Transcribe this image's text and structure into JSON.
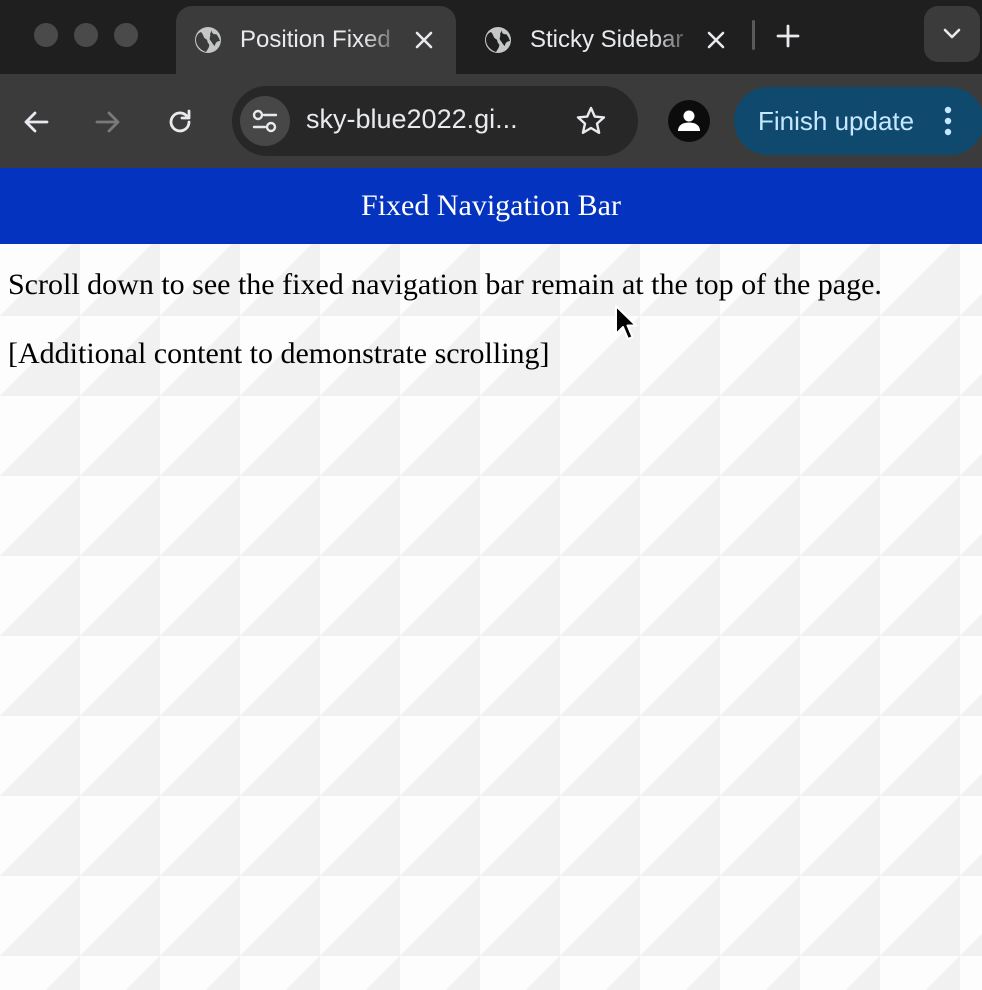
{
  "browser": {
    "tabs": [
      {
        "title": "Position Fixed",
        "active": true,
        "icon": "globe-icon"
      },
      {
        "title": "Sticky Sidebar",
        "active": false,
        "icon": "globe-icon"
      }
    ],
    "address_bar": {
      "url": "sky-blue2022.gi..."
    },
    "update_button": {
      "label": "Finish update"
    },
    "colors": {
      "chrome_dark": "#1f1f1f",
      "toolbar": "#3b3b3b",
      "update_bg": "#0f4a6e",
      "update_text": "#c6e7ff"
    }
  },
  "page": {
    "nav_title": "Fixed Navigation Bar",
    "paragraph_1": "Scroll down to see the fixed navigation bar remain at the top of the page.",
    "paragraph_2": "[Additional content to demonstrate scrolling]",
    "colors": {
      "nav_bg": "#0433bf",
      "nav_text": "#ffffff"
    }
  }
}
